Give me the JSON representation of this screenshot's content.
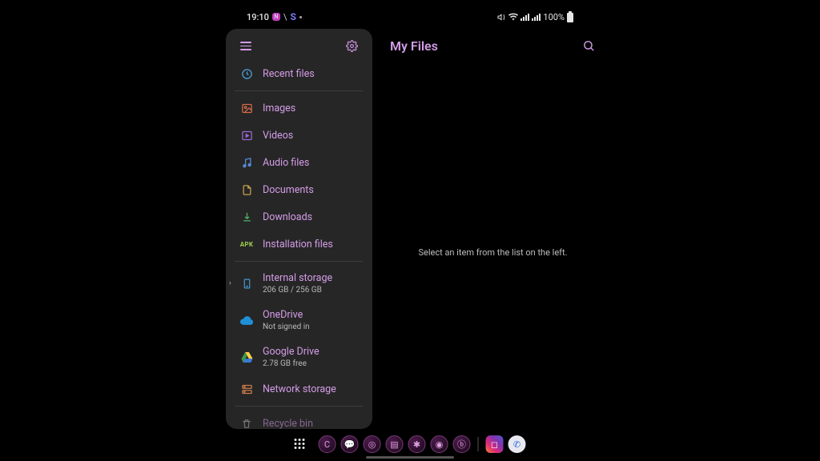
{
  "status": {
    "time": "19:10",
    "notif_pill": "N",
    "notif_s": "S",
    "battery_text": "100%"
  },
  "sidebar": {
    "recent": "Recent files",
    "categories": {
      "images": "Images",
      "videos": "Videos",
      "audio": "Audio files",
      "documents": "Documents",
      "downloads": "Downloads",
      "installation": "Installation files"
    },
    "storage": {
      "internal_label": "Internal storage",
      "internal_sub": "206 GB / 256 GB",
      "onedrive_label": "OneDrive",
      "onedrive_sub": "Not signed in",
      "gdrive_label": "Google Drive",
      "gdrive_sub": "2.78 GB free",
      "network_label": "Network storage"
    },
    "recycle": "Recycle bin"
  },
  "main": {
    "title": "My Files",
    "empty_hint": "Select an item from the list on the left."
  },
  "dock": {
    "icons": [
      "C",
      "chat",
      "chrome",
      "note",
      "star",
      "camera",
      "bixby"
    ],
    "pinned": [
      "instagram",
      "phone"
    ]
  },
  "colors": {
    "accent": "#d49de8",
    "panel": "#262626"
  }
}
